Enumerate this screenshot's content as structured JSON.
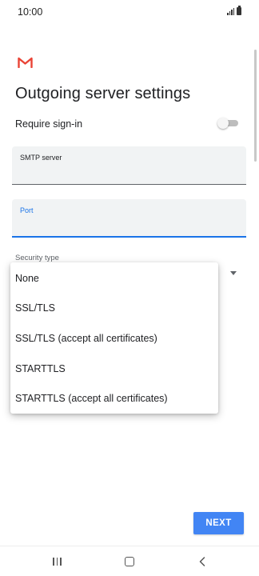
{
  "status_bar": {
    "time": "10:00"
  },
  "app": {
    "logo": "gmail-icon",
    "title": "Outgoing server settings"
  },
  "require_signin": {
    "label": "Require sign-in",
    "enabled": false
  },
  "smtp_server": {
    "label": "SMTP server",
    "value": ""
  },
  "port": {
    "label": "Port",
    "value": ""
  },
  "security_type": {
    "label": "Security type",
    "options": [
      "None",
      "SSL/TLS",
      "SSL/TLS (accept all certificates)",
      "STARTTLS",
      "STARTTLS (accept all certificates)"
    ]
  },
  "footer": {
    "next_label": "NEXT"
  },
  "colors": {
    "accent": "#1a73e8",
    "button": "#4285f4",
    "gmail_red": "#ea4335"
  },
  "nav_icons": [
    "recent-apps-icon",
    "home-icon",
    "back-icon"
  ]
}
